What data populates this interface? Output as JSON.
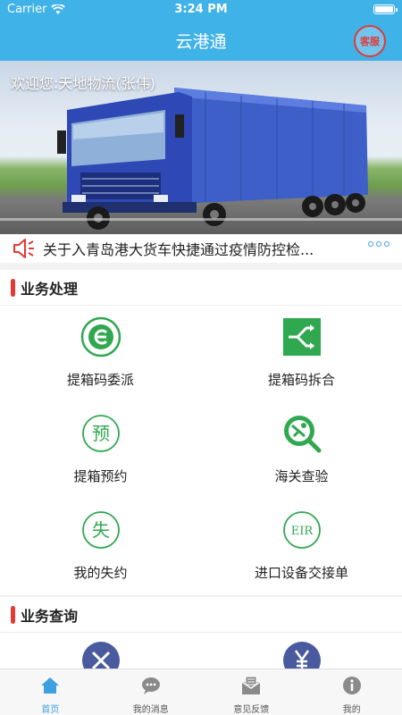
{
  "status_bar": {
    "carrier": "Carrier",
    "time": "3:24 PM"
  },
  "nav": {
    "title": "云港通",
    "service_label": "客服"
  },
  "banner": {
    "welcome": "欢迎您:天地物流(张伟)"
  },
  "notice": {
    "text": "关于入青岛港大货车快捷通过疫情防控检..."
  },
  "sections": {
    "business_processing": {
      "title": "业务处理",
      "items": [
        {
          "label": "提箱码委派",
          "icon": "e-code-icon"
        },
        {
          "label": "提箱码拆合",
          "icon": "split-merge-icon"
        },
        {
          "label": "提箱预约",
          "icon": "reservation-icon",
          "icon_text": "预"
        },
        {
          "label": "海关查验",
          "icon": "customs-inspection-icon"
        },
        {
          "label": "我的失约",
          "icon": "default-icon",
          "icon_text": "失"
        },
        {
          "label": "进口设备交接单",
          "icon": "eir-icon",
          "icon_text": "EIR"
        }
      ]
    },
    "business_query": {
      "title": "业务查询"
    }
  },
  "tabs": [
    {
      "label": "首页",
      "icon": "home-icon",
      "active": true
    },
    {
      "label": "我的消息",
      "icon": "message-icon",
      "active": false
    },
    {
      "label": "意见反馈",
      "icon": "feedback-icon",
      "active": false
    },
    {
      "label": "我的",
      "icon": "info-icon",
      "active": false
    }
  ],
  "colors": {
    "primary": "#3fb2e8",
    "accent_green": "#2fa84f",
    "alert_red": "#e53935",
    "tab_active": "#3fa0e0"
  }
}
